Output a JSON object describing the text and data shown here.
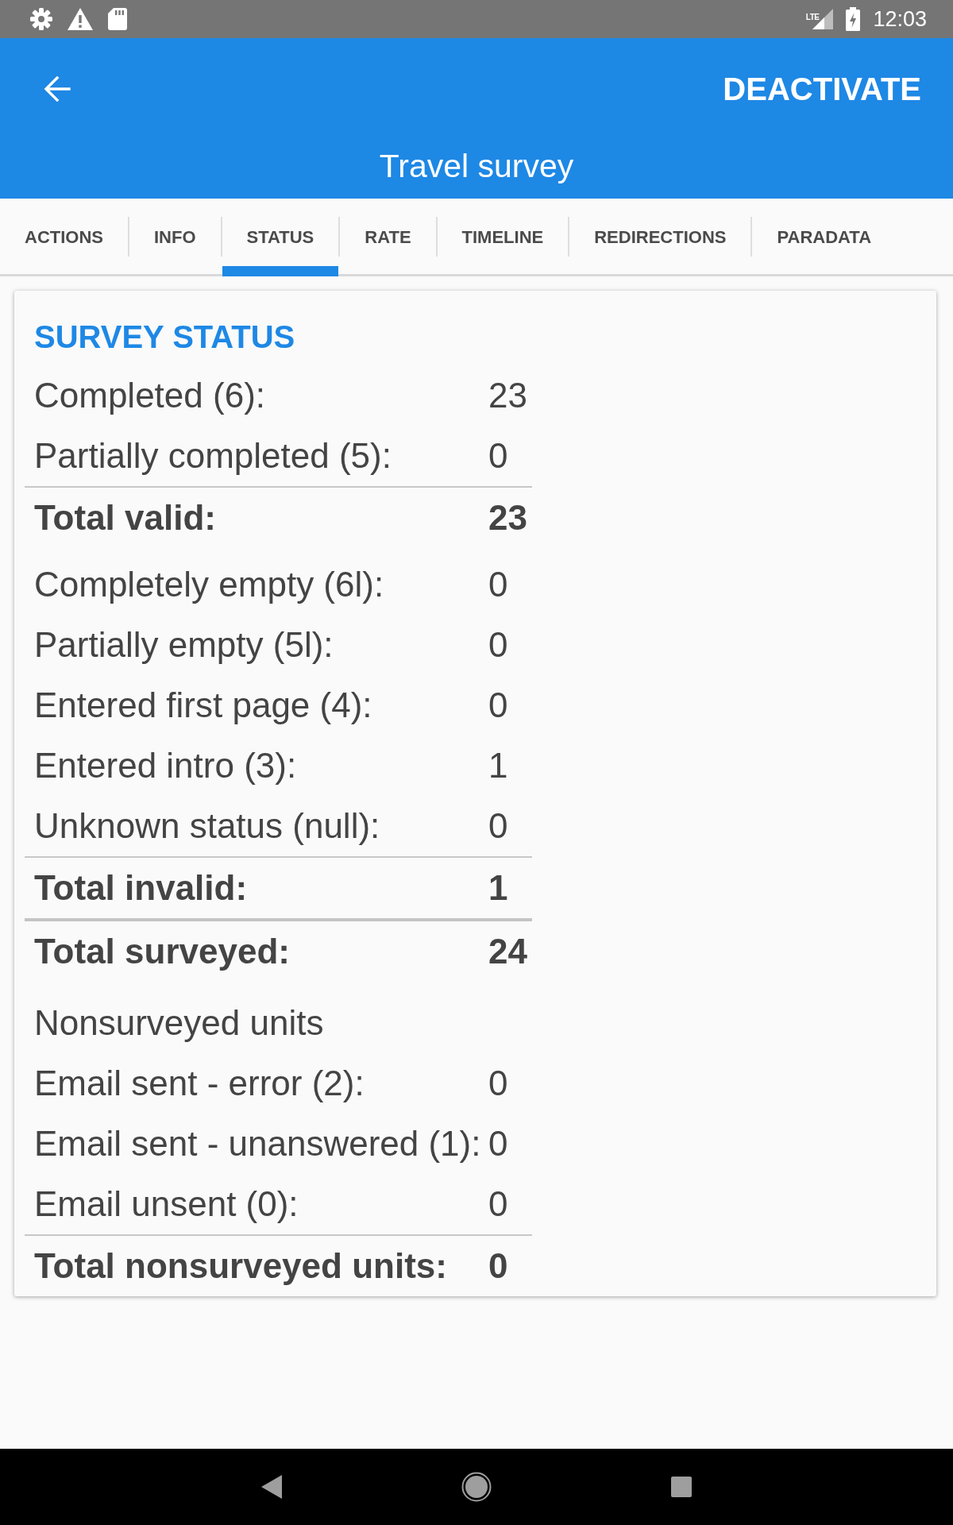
{
  "status_bar": {
    "network": "LTE",
    "time": "12:03"
  },
  "app_bar": {
    "action": "DEACTIVATE",
    "title": "Travel survey"
  },
  "tabs": [
    {
      "label": "ACTIONS",
      "selected": false
    },
    {
      "label": "INFO",
      "selected": false
    },
    {
      "label": "STATUS",
      "selected": true
    },
    {
      "label": "RATE",
      "selected": false
    },
    {
      "label": "TIMELINE",
      "selected": false
    },
    {
      "label": "REDIRECTIONS",
      "selected": false
    },
    {
      "label": "PARADATA",
      "selected": false
    }
  ],
  "survey_status": {
    "title": "SURVEY STATUS",
    "rows": [
      {
        "kind": "item",
        "label": "Completed (6):",
        "value": "23"
      },
      {
        "kind": "item",
        "label": "Partially completed (5):",
        "value": "0"
      },
      {
        "kind": "total",
        "label": "Total valid:",
        "value": "23"
      },
      {
        "kind": "item",
        "label": "Completely empty (6l):",
        "value": "0"
      },
      {
        "kind": "item",
        "label": "Partially empty (5l):",
        "value": "0"
      },
      {
        "kind": "item",
        "label": "Entered first page (4):",
        "value": "0"
      },
      {
        "kind": "item",
        "label": "Entered intro (3):",
        "value": "1"
      },
      {
        "kind": "item",
        "label": "Unknown status (null):",
        "value": "0"
      },
      {
        "kind": "total",
        "label": "Total invalid:",
        "value": "1"
      },
      {
        "kind": "grand_total",
        "label": "Total surveyed:",
        "value": "24"
      },
      {
        "kind": "heading",
        "label": "Nonsurveyed units"
      },
      {
        "kind": "item",
        "label": "Email sent - error (2):",
        "value": "0"
      },
      {
        "kind": "item",
        "label": "Email sent - unanswered (1):",
        "value": "0"
      },
      {
        "kind": "item",
        "label": "Email unsent (0):",
        "value": "0"
      },
      {
        "kind": "total",
        "label": "Total nonsurveyed units:",
        "value": "0"
      }
    ]
  }
}
